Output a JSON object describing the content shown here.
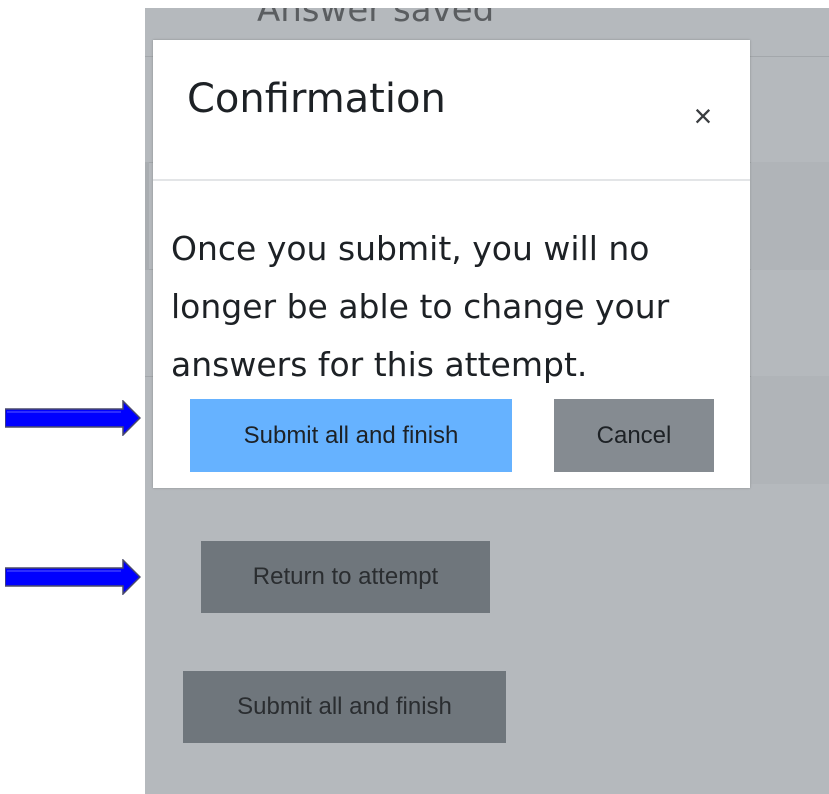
{
  "background": {
    "status_text": "Answer saved",
    "return_button_label": "Return to attempt",
    "submit_button_label": "Submit all and finish"
  },
  "modal": {
    "title": "Confirmation",
    "close_symbol": "×",
    "message": "Once you submit, you will no longer be able to change your answers for this attempt.",
    "confirm_label": "Submit all and finish",
    "cancel_label": "Cancel"
  },
  "icons": {
    "arrow": "arrow-right-icon",
    "close": "close-icon"
  },
  "colors": {
    "confirm_button": "#66b2ff",
    "cancel_button": "#858b91",
    "backdrop": "#b5b9bd",
    "arrow_fill": "#0000ff"
  }
}
